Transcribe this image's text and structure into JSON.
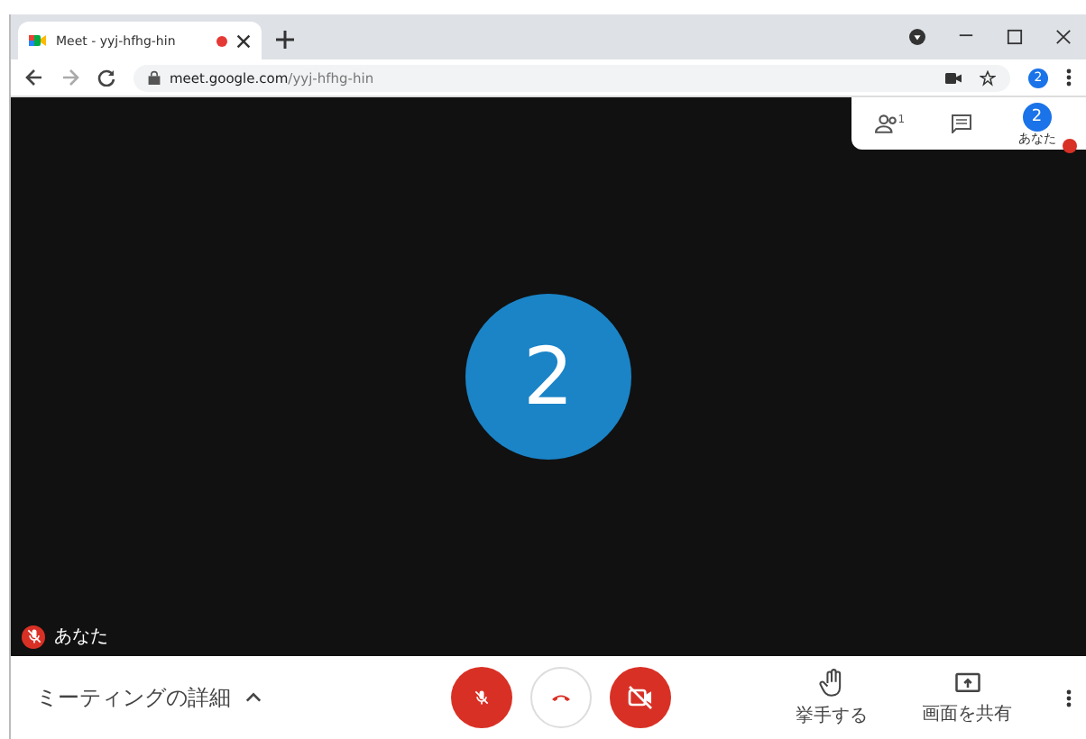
{
  "tab": {
    "title": "Meet - yyj-hfhg-hin",
    "recording": true
  },
  "address_bar": {
    "url_host": "meet.google.com",
    "url_path": "/yyj-hfhg-hin",
    "profile": "2"
  },
  "top_panel": {
    "participants_count": "1",
    "self_avatar": "2",
    "self_label": "あなた"
  },
  "main_tile": {
    "avatar": "2",
    "name": "あなた",
    "mic_on": false
  },
  "bottom_bar": {
    "details": "ミーティングの詳細",
    "mic_on": false,
    "camera_on": false,
    "actions": [
      {
        "kind": "hand",
        "label": "挙手する"
      },
      {
        "kind": "present",
        "label": "画面を共有"
      }
    ]
  }
}
